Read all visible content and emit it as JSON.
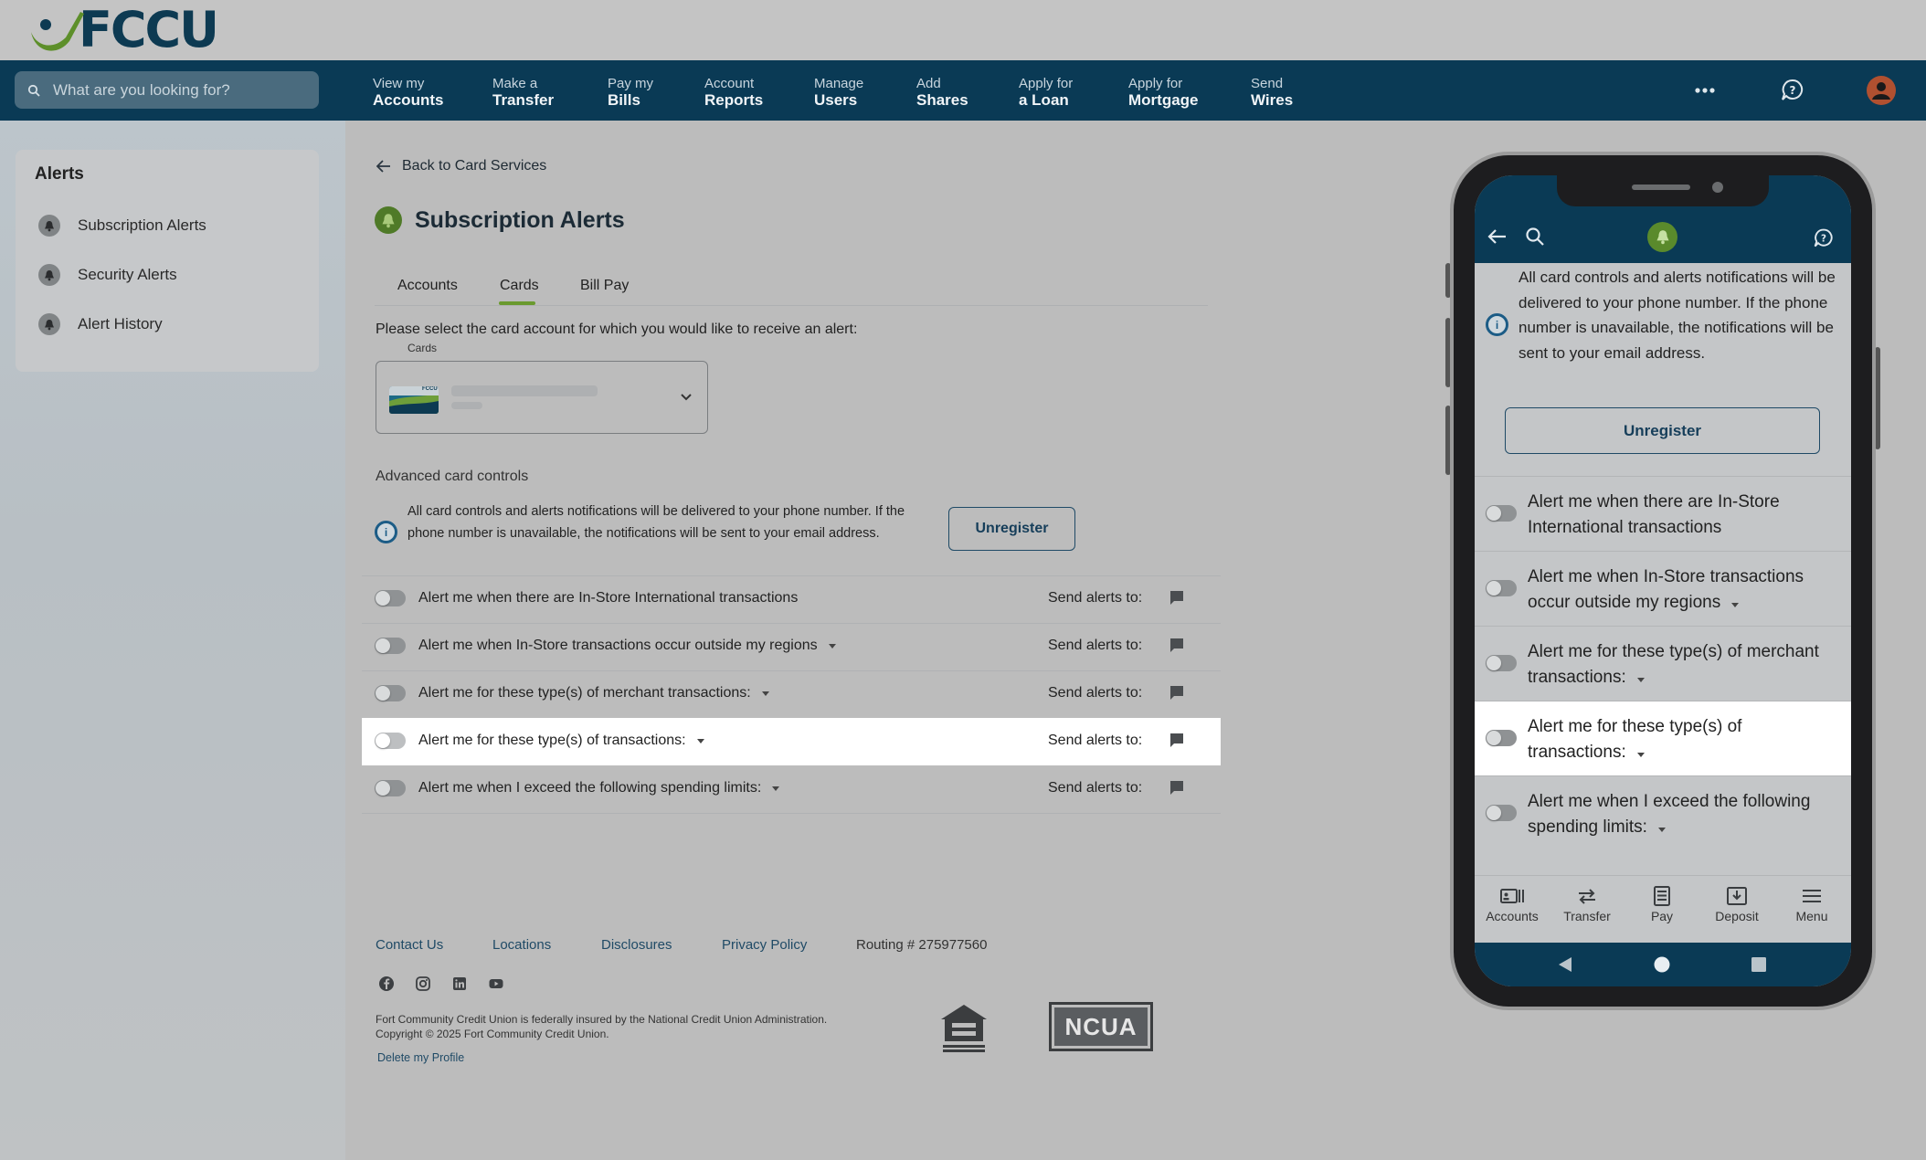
{
  "brand": {
    "name": "FCCU",
    "primary": "#0a3a55",
    "accent": "#6a9a2f"
  },
  "search": {
    "placeholder": "What are you looking for?"
  },
  "nav": [
    {
      "top": "View my",
      "bottom": "Accounts"
    },
    {
      "top": "Make a",
      "bottom": "Transfer"
    },
    {
      "top": "Pay my",
      "bottom": "Bills"
    },
    {
      "top": "Account",
      "bottom": "Reports"
    },
    {
      "top": "Manage",
      "bottom": "Users"
    },
    {
      "top": "Add",
      "bottom": "Shares"
    },
    {
      "top": "Apply for",
      "bottom": "a Loan"
    },
    {
      "top": "Apply for",
      "bottom": "Mortgage"
    },
    {
      "top": "Send",
      "bottom": "Wires"
    }
  ],
  "sidebar": {
    "title": "Alerts",
    "items": [
      {
        "label": "Subscription Alerts",
        "icon": "bell-icon"
      },
      {
        "label": "Security Alerts",
        "icon": "bell-icon"
      },
      {
        "label": "Alert History",
        "icon": "bell-icon"
      }
    ]
  },
  "main": {
    "back_label": "Back to Card Services",
    "title": "Subscription Alerts",
    "tabs": [
      {
        "label": "Accounts",
        "active": false
      },
      {
        "label": "Cards",
        "active": true
      },
      {
        "label": "Bill Pay",
        "active": false
      }
    ],
    "prompt": "Please select the card account for which you would like to receive an alert:",
    "card_select": {
      "label": "Cards",
      "thumb_text": "FCCU"
    },
    "advanced_title": "Advanced card controls",
    "info_text": "All card controls and alerts notifications will be delivered to your phone number. If the phone number is unavailable, the notifications will be sent to your email address.",
    "unregister_label": "Unregister",
    "send_alerts_label": "Send alerts to:",
    "alerts": [
      {
        "label": "Alert me when there are In-Store International transactions",
        "dropdown": false,
        "highlighted": false
      },
      {
        "label": "Alert me when In-Store transactions occur outside my regions",
        "dropdown": true,
        "highlighted": false
      },
      {
        "label": "Alert me for these type(s) of merchant transactions:",
        "dropdown": true,
        "highlighted": false
      },
      {
        "label": "Alert me for these type(s) of transactions:",
        "dropdown": true,
        "highlighted": true
      },
      {
        "label": "Alert me when I exceed the following spending limits:",
        "dropdown": true,
        "highlighted": false
      }
    ]
  },
  "footer": {
    "links": [
      "Contact Us",
      "Locations",
      "Disclosures",
      "Privacy Policy"
    ],
    "routing": "Routing # 275977560",
    "social": [
      "facebook-icon",
      "instagram-icon",
      "linkedin-icon",
      "youtube-icon"
    ],
    "legal_1": "Fort Community Credit Union is federally insured by the National Credit Union Administration.",
    "legal_2": "Copyright © 2025 Fort Community Credit Union.",
    "delete_label": "Delete my Profile",
    "ncua_label": "NCUA"
  },
  "phone": {
    "info_text": "All card controls and alerts notifications will be delivered to your phone number. If the phone number is unavailable, the notifications will be sent to your email address.",
    "unregister_label": "Unregister",
    "alerts": [
      {
        "label": "Alert me when there are In-Store International transactions",
        "dropdown": false,
        "highlighted": false
      },
      {
        "label": "Alert me when In-Store transactions occur outside my regions",
        "dropdown": true,
        "highlighted": false
      },
      {
        "label": "Alert me for these type(s) of merchant transactions:",
        "dropdown": true,
        "highlighted": false
      },
      {
        "label": "Alert me for these type(s) of transactions:",
        "dropdown": true,
        "highlighted": true
      },
      {
        "label": "Alert me when I exceed the following spending limits:",
        "dropdown": true,
        "highlighted": false
      }
    ],
    "tabbar": [
      {
        "label": "Accounts",
        "icon": "accounts-icon"
      },
      {
        "label": "Transfer",
        "icon": "transfer-icon"
      },
      {
        "label": "Pay",
        "icon": "pay-icon"
      },
      {
        "label": "Deposit",
        "icon": "deposit-icon"
      },
      {
        "label": "Menu",
        "icon": "menu-icon"
      }
    ]
  }
}
